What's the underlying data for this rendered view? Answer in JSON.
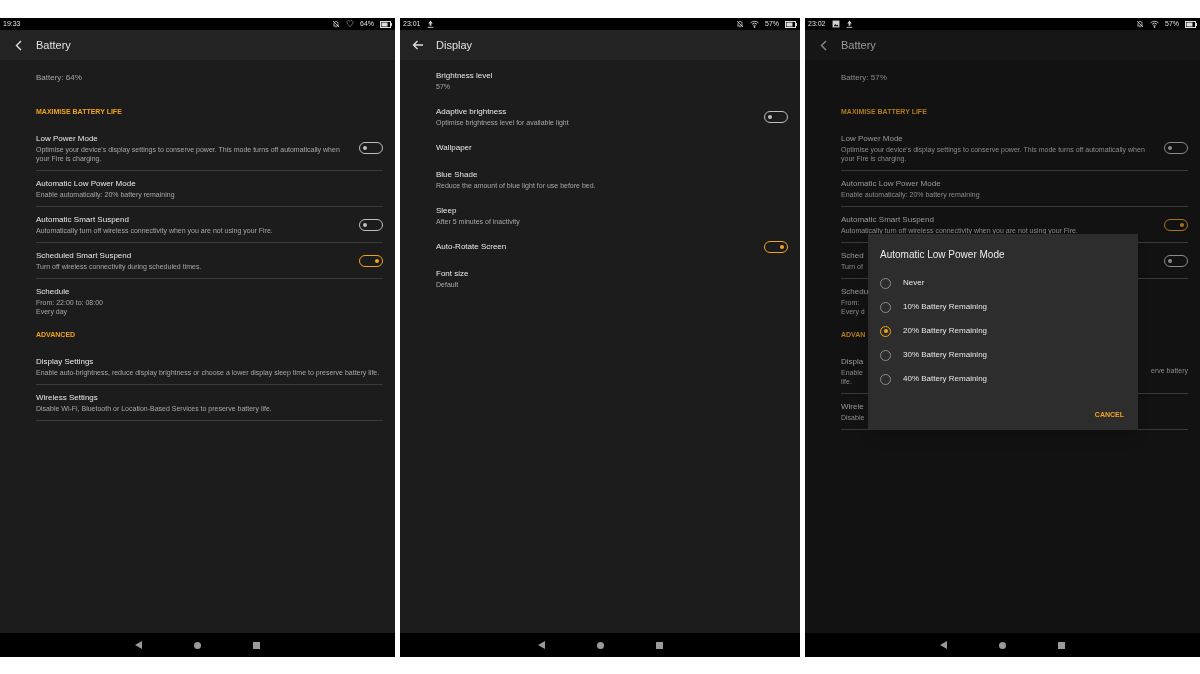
{
  "screens": [
    {
      "status_bar": {
        "time": "19:33",
        "right_icons": [
          {
            "kind": "mute"
          },
          {
            "kind": "shield"
          }
        ],
        "battery": "64%"
      },
      "back": {
        "kind": "chevron"
      },
      "title": "Battery",
      "dimmed": false,
      "items": [
        {
          "kind": "info",
          "text": "Battery: 64%"
        },
        {
          "kind": "section",
          "text": "MAXIMISE BATTERY LIFE"
        },
        {
          "kind": "setting",
          "title": "Low Power Mode",
          "lines": [
            "Optimise your device's display settings to conserve power. This mode turns off automatically when your Fire is charging."
          ],
          "on": false,
          "divider": true
        },
        {
          "kind": "setting",
          "title": "Automatic Low Power Mode",
          "lines": [
            "Enable automatically: 20% battery remaining"
          ],
          "divider": true
        },
        {
          "kind": "setting",
          "title": "Automatic Smart Suspend",
          "lines": [
            "Automatically turn off wireless connectivity when you are not using your Fire."
          ],
          "on": false,
          "divider": true
        },
        {
          "kind": "setting",
          "title": "Scheduled Smart Suspend",
          "lines": [
            "Turn off wireless connectivity during scheduled times."
          ],
          "on": true,
          "divider": true
        },
        {
          "kind": "setting",
          "title": "Schedule",
          "lines": [
            "From: 22:00 to: 08:00",
            "Every day"
          ],
          "divider": false
        },
        {
          "kind": "section",
          "text": "ADVANCED"
        },
        {
          "kind": "setting",
          "title": "Display Settings",
          "lines": [
            "Enable auto-brightness, reduce display brightness or choose a lower display sleep time to preserve battery life."
          ],
          "divider": true
        },
        {
          "kind": "setting",
          "title": "Wireless Settings",
          "lines": [
            "Disable Wi-Fi, Bluetooth or Location-Based Services to preserve battery life."
          ],
          "divider": true
        }
      ]
    },
    {
      "status_bar": {
        "time": "23:01",
        "left_icons": [
          {
            "kind": "upload"
          }
        ],
        "right_icons": [
          {
            "kind": "mute"
          },
          {
            "kind": "wifi"
          }
        ],
        "battery": "57%"
      },
      "back": {
        "kind": "arrow"
      },
      "title": "Display",
      "dimmed": false,
      "items": [
        {
          "kind": "setting",
          "title": "Brightness level",
          "lines": [
            "57%"
          ],
          "divider": false
        },
        {
          "kind": "setting",
          "title": "Adaptive brightness",
          "lines": [
            "Optimise brightness level for available light"
          ],
          "on": false,
          "divider": false
        },
        {
          "kind": "setting",
          "title": "Wallpaper",
          "divider": false
        },
        {
          "kind": "setting",
          "title": "Blue Shade",
          "lines": [
            "Reduce the amount of blue light for use before bed."
          ],
          "divider": false
        },
        {
          "kind": "setting",
          "title": "Sleep",
          "lines": [
            "After 5 minutes of inactivity"
          ],
          "divider": false
        },
        {
          "kind": "setting",
          "title": "Auto-Rotate Screen",
          "on": true,
          "divider": false
        },
        {
          "kind": "setting",
          "title": "Font size",
          "lines": [
            "Default"
          ],
          "divider": false
        }
      ]
    },
    {
      "status_bar": {
        "time": "23:02",
        "left_icons": [
          {
            "kind": "image"
          },
          {
            "kind": "upload"
          }
        ],
        "right_icons": [
          {
            "kind": "mute"
          },
          {
            "kind": "wifi"
          }
        ],
        "battery": "57%"
      },
      "back": {
        "kind": "chevron"
      },
      "title": "Battery",
      "dimmed": true,
      "items": [
        {
          "kind": "info",
          "text": "Battery: 57%"
        },
        {
          "kind": "section",
          "text": "MAXIMISE BATTERY LIFE"
        },
        {
          "kind": "setting",
          "title": "Low Power Mode",
          "lines": [
            "Optimise your device's display settings to conserve power. This mode turns off automatically when your Fire is charging."
          ],
          "on": false,
          "divider": true
        },
        {
          "kind": "setting",
          "title": "Automatic Low Power Mode",
          "lines": [
            "Enable automatically: 20% battery remaining"
          ],
          "divider": true
        },
        {
          "kind": "setting",
          "title": "Automatic Smart Suspend",
          "lines": [
            "Automatically turn off wireless connectivity when you are not using your Fire."
          ],
          "on": true,
          "divider": true
        },
        {
          "kind": "setting",
          "title": "Sched",
          "lines": [
            "Turn of"
          ],
          "on": false,
          "divider": true
        },
        {
          "kind": "setting",
          "title": "Schedu",
          "lines": [
            "From:",
            "Every d"
          ],
          "divider": false
        },
        {
          "kind": "section",
          "text": "ADVAN"
        },
        {
          "kind": "setting",
          "title": "Displa",
          "lines": [
            "Enable",
            "life."
          ],
          "right": "erve battery",
          "divider": true
        },
        {
          "kind": "setting",
          "title": "Wirele",
          "lines": [
            "Disable"
          ],
          "divider": true
        }
      ],
      "dialog": {
        "title": "Automatic Low Power Mode",
        "options": [
          {
            "label": "Never",
            "selected": false
          },
          {
            "label": "10% Battery Remaining",
            "selected": false
          },
          {
            "label": "20% Battery Remaining",
            "selected": true
          },
          {
            "label": "30% Battery Remaining",
            "selected": false
          },
          {
            "label": "40% Battery Remaining",
            "selected": false
          }
        ],
        "button": "CANCEL"
      }
    }
  ]
}
